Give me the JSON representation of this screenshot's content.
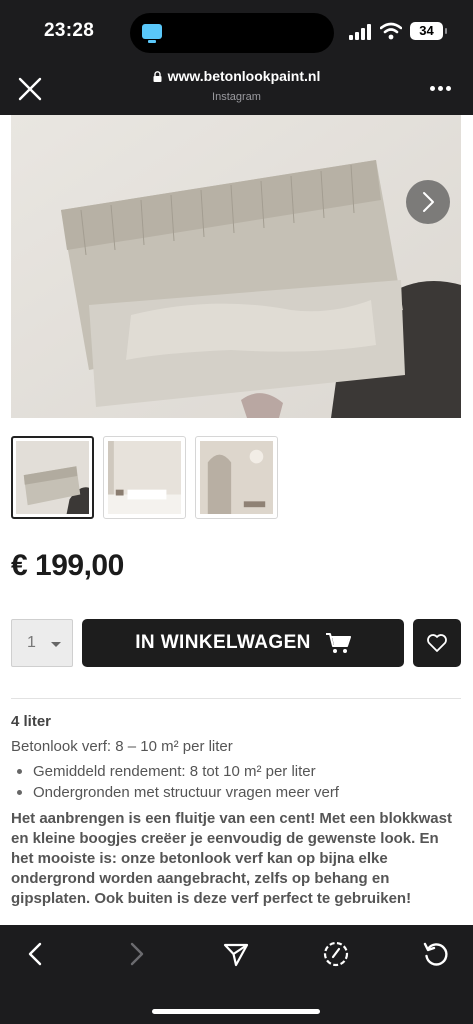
{
  "status_bar": {
    "time": "23:28",
    "battery": "34",
    "island_icon": "tv-app-icon",
    "signal_icon": "cellular-signal-icon",
    "wifi_icon": "wifi-icon"
  },
  "browser": {
    "url": "www.betonlookpaint.nl",
    "source": "Instagram",
    "close_icon": "close-icon",
    "lock_icon": "lock-icon",
    "more_icon": "more-dots-icon"
  },
  "product": {
    "images": [
      {
        "name": "paint-brush-photo",
        "active": true
      },
      {
        "name": "bedroom-photo",
        "active": false
      },
      {
        "name": "arched-hallway-photo",
        "active": false
      }
    ],
    "next_icon": "chevron-right-icon",
    "price": "€ 199,00",
    "quantity": "1",
    "add_to_cart_label": "IN WINKELWAGEN",
    "cart_icon": "shopping-cart-icon",
    "wishlist_icon": "heart-icon"
  },
  "description": {
    "title": "4 liter",
    "coverage": "Betonlook verf: 8 – 10 m² per liter",
    "bullets": [
      "Gemiddeld rendement: 8 tot 10 m² per liter",
      "Ondergronden met structuur vragen meer verf"
    ],
    "body": "Het aanbrengen is een fluitje van een cent! Met een blokkwast en kleine boogjes creëer je eenvoudig de gewenste look. En het mooiste is: onze betonlook verf kan op bijna elke ondergrond worden aangebracht, zelfs op behang en gipsplaten. Ook buiten is deze verf perfect te gebruiken!"
  },
  "bottom_nav": {
    "icons": [
      "back-icon",
      "forward-icon",
      "share-icon",
      "compass-icon",
      "reload-icon"
    ]
  },
  "colors": {
    "chrome": "#1c1c1e",
    "button": "#1d1d1d",
    "text": "#555555",
    "background": "#ffffff"
  }
}
